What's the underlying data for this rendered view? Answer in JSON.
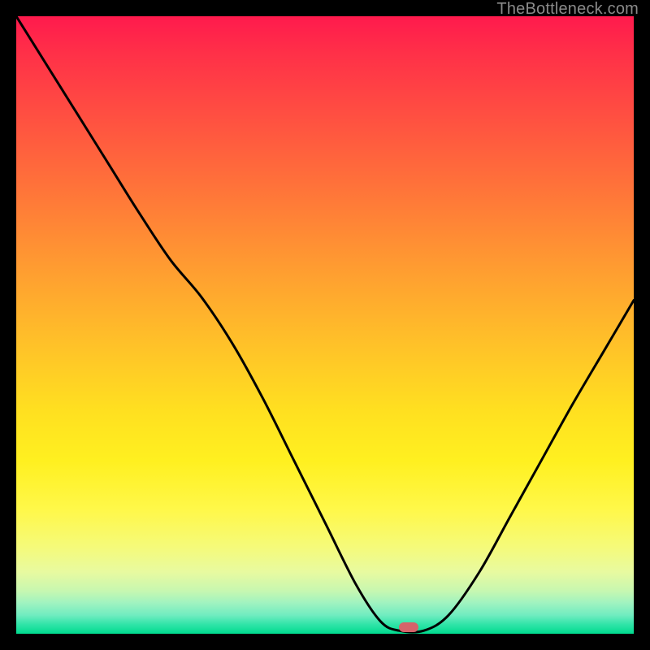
{
  "watermark": "TheBottleneck.com",
  "marker": {
    "cx_frac": 0.636,
    "cy_frac": 0.99
  },
  "chart_data": {
    "type": "line",
    "title": "",
    "xlabel": "",
    "ylabel": "",
    "xlim": [
      0,
      1
    ],
    "ylim": [
      0,
      1
    ],
    "series": [
      {
        "name": "bottleneck-curve",
        "x": [
          0.0,
          0.05,
          0.1,
          0.15,
          0.2,
          0.25,
          0.3,
          0.35,
          0.4,
          0.45,
          0.5,
          0.55,
          0.59,
          0.62,
          0.66,
          0.7,
          0.75,
          0.8,
          0.85,
          0.9,
          0.95,
          1.0
        ],
        "y": [
          1.0,
          0.92,
          0.84,
          0.76,
          0.68,
          0.605,
          0.545,
          0.47,
          0.38,
          0.28,
          0.18,
          0.08,
          0.02,
          0.005,
          0.005,
          0.03,
          0.1,
          0.19,
          0.28,
          0.37,
          0.455,
          0.54
        ]
      }
    ],
    "gradient_stops": [
      {
        "pos": 0.0,
        "color": "#ff1a4d"
      },
      {
        "pos": 0.5,
        "color": "#ffc428"
      },
      {
        "pos": 0.8,
        "color": "#fff84a"
      },
      {
        "pos": 1.0,
        "color": "#00db8e"
      }
    ]
  }
}
